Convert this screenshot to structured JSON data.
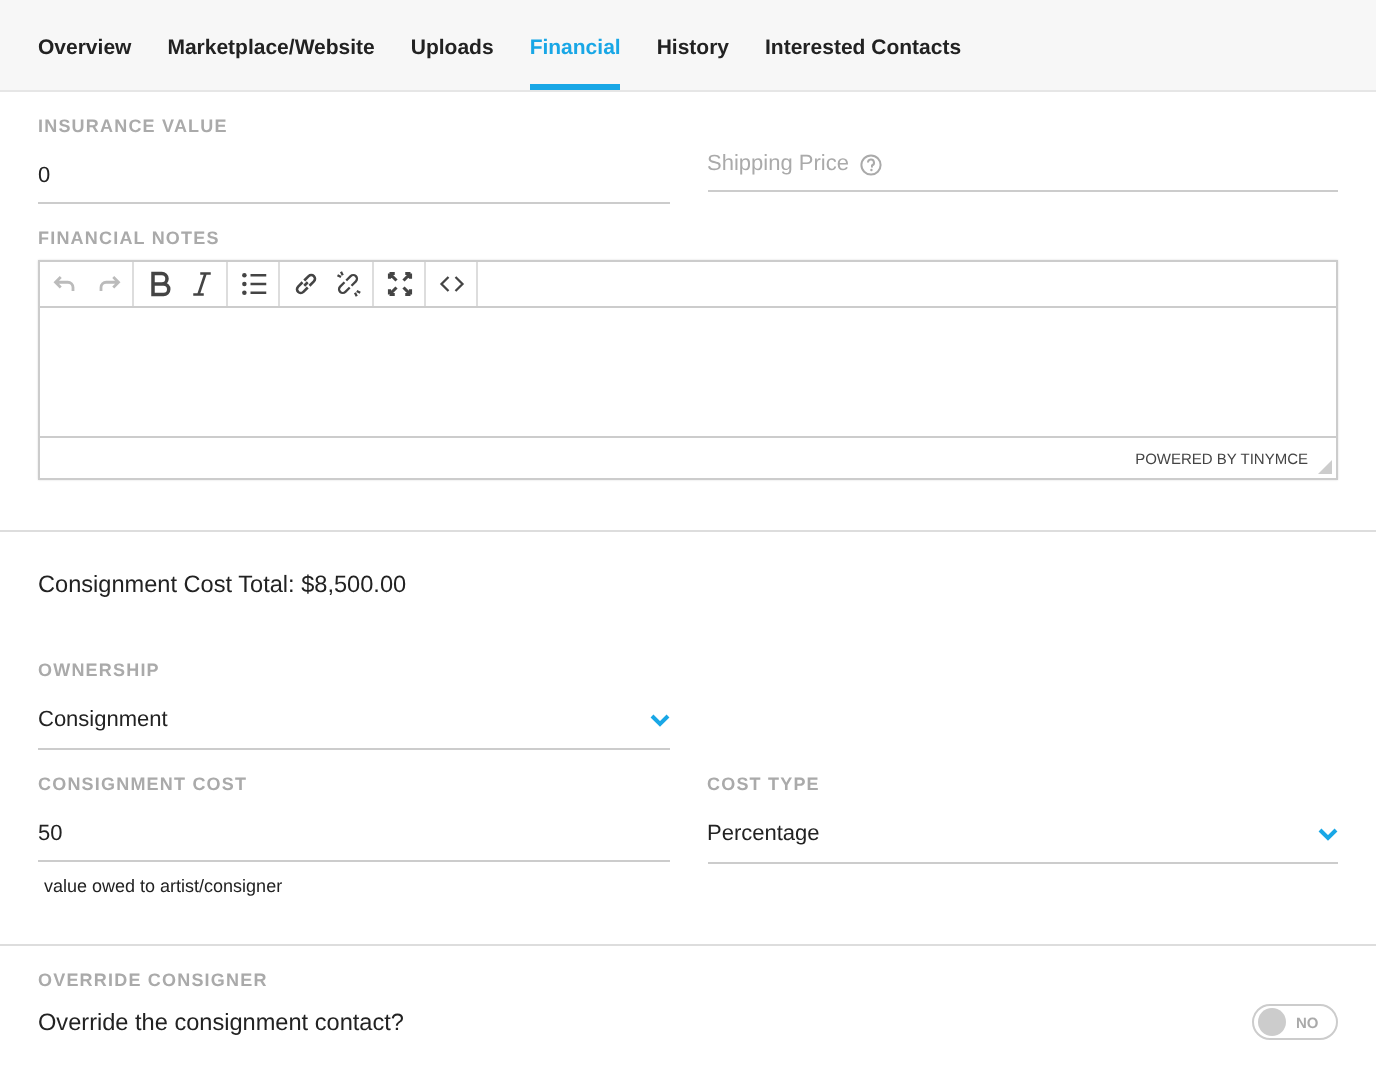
{
  "tabs": [
    {
      "label": "Overview",
      "selected": false
    },
    {
      "label": "Marketplace/Website",
      "selected": false
    },
    {
      "label": "Uploads",
      "selected": false
    },
    {
      "label": "Financial",
      "selected": true
    },
    {
      "label": "History",
      "selected": false
    },
    {
      "label": "Interested Contacts",
      "selected": false
    }
  ],
  "insurance": {
    "label": "INSURANCE VALUE",
    "value": "0"
  },
  "shipping": {
    "placeholder": "Shipping Price"
  },
  "notes": {
    "label": "FINANCIAL NOTES",
    "toolbar": [
      {
        "kind": "undo",
        "disabled": true
      },
      {
        "kind": "redo",
        "disabled": true
      },
      {
        "kind": "bold",
        "disabled": false
      },
      {
        "kind": "italic",
        "disabled": false
      },
      {
        "kind": "list",
        "disabled": false
      },
      {
        "kind": "link",
        "disabled": false
      },
      {
        "kind": "unlink",
        "disabled": false
      },
      {
        "kind": "fullscreen",
        "disabled": false
      },
      {
        "kind": "code",
        "disabled": false
      }
    ],
    "branding": "POWERED BY TINYMCE"
  },
  "total": "Consignment Cost Total: $8,500.00",
  "ownership": {
    "label": "OWNERSHIP",
    "value": "Consignment"
  },
  "consignment_cost": {
    "label": "CONSIGNMENT COST",
    "value": "50",
    "hint": "value owed to artist/consigner"
  },
  "cost_type": {
    "label": "COST TYPE",
    "value": "Percentage"
  },
  "override": {
    "label": "OVERRIDE CONSIGNER",
    "question": "Override the consignment contact?",
    "toggle": {
      "on": false,
      "label": "NO"
    }
  }
}
